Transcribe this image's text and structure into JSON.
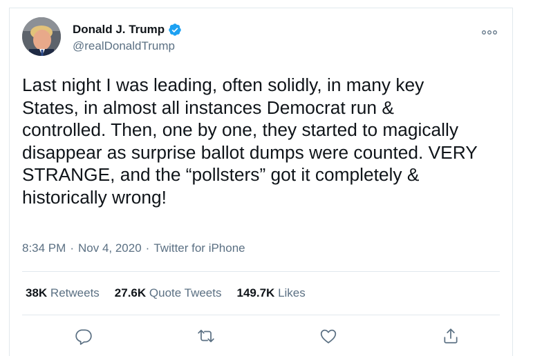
{
  "user": {
    "name": "Donald J. Trump",
    "handle": "@realDonaldTrump",
    "verified": true
  },
  "tweet": {
    "text": "Last night I was leading, often solidly, in many key\nStates, in almost all instances Democrat run &\ncontrolled. Then, one by one, they started to magically\ndisappear as surprise ballot dumps were counted. VERY\nSTRANGE, and the “pollsters” got it completely &\nhistorically wrong!",
    "time": "8:34 PM",
    "date": "Nov 4, 2020",
    "source": "Twitter for iPhone",
    "separator": "·"
  },
  "stats": {
    "retweets_count": "38K",
    "retweets_label": "Retweets",
    "quotes_count": "27.6K",
    "quotes_label": "Quote Tweets",
    "likes_count": "149.7K",
    "likes_label": "Likes"
  },
  "icons": {
    "more": "more-horizontal-icon",
    "reply": "reply-icon",
    "retweet": "retweet-icon",
    "like": "heart-icon",
    "share": "share-icon",
    "verified": "verified-badge-icon"
  },
  "colors": {
    "brand_blue": "#1da1f2",
    "text": "#0f1419",
    "secondary": "#5b7083",
    "border": "#e1e8ed"
  }
}
